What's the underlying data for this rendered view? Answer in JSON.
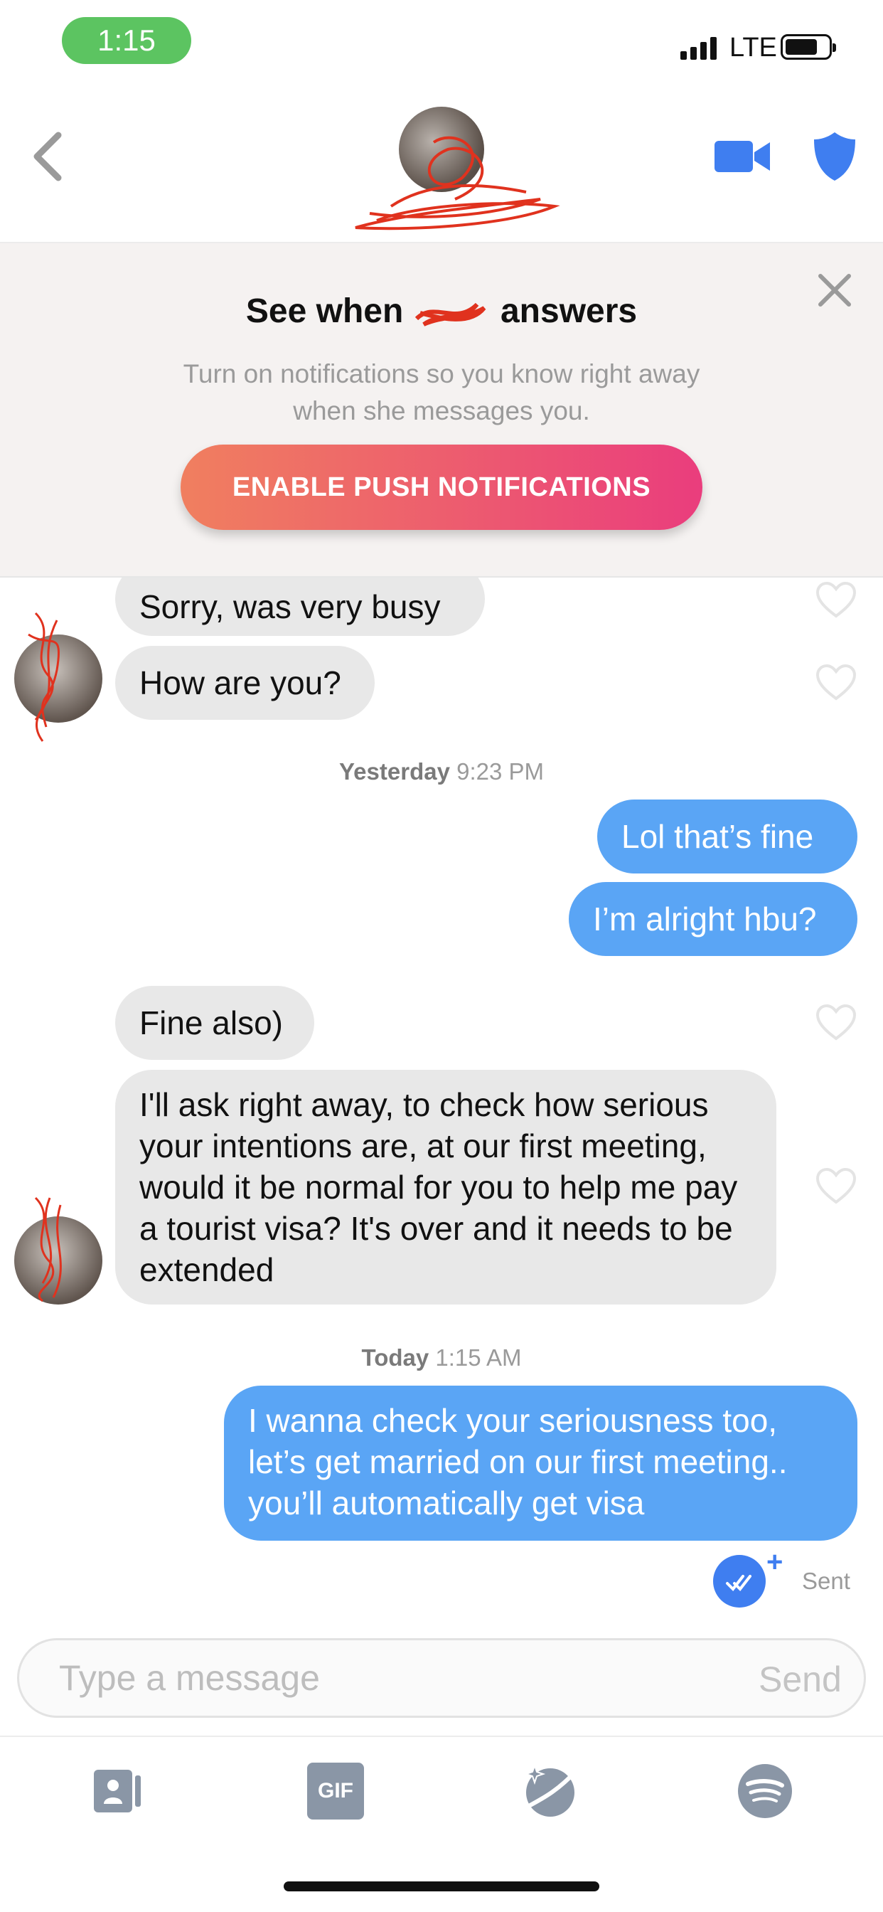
{
  "status_bar": {
    "time": "1:15",
    "network": "LTE"
  },
  "header": {
    "back_icon": "chevron-left-icon",
    "video_icon": "video-camera-icon",
    "safety_icon": "shield-icon",
    "accent_color": "#3f7ef0"
  },
  "banner": {
    "title_before": "See when",
    "title_after": "answers",
    "description": "Turn on notifications so you know right away when she messages you.",
    "button_label": "ENABLE PUSH NOTIFICATIONS",
    "close_icon": "close-icon",
    "gradient": [
      "#f07f5f",
      "#ea3d7d"
    ]
  },
  "messages": [
    {
      "direction": "in",
      "text": "Sorry, was very busy"
    },
    {
      "direction": "in",
      "text": "How are you?"
    },
    {
      "direction": "out",
      "text": "Lol that’s fine"
    },
    {
      "direction": "out",
      "text": "I’m alright hbu?"
    },
    {
      "direction": "in",
      "text": "Fine also)"
    },
    {
      "direction": "in",
      "text": "I'll ask right away, to check how serious your intentions are, at our first meeting, would it be normal for you to help me pay a tourist visa? It's over and it needs to be extended"
    },
    {
      "direction": "out",
      "text": "I wanna check your seriousness too, let’s get married on our first meeting.. you’ll automatically get visa"
    }
  ],
  "timestamps": [
    {
      "day": "Yesterday",
      "time": "9:23 PM"
    },
    {
      "day": "Today",
      "time": "1:15 AM"
    }
  ],
  "delivery": {
    "status": "Sent",
    "plus": "+"
  },
  "composer": {
    "placeholder": "Type a message",
    "send_label": "Send"
  },
  "toolbar": {
    "items": [
      {
        "icon": "contact-card-icon"
      },
      {
        "icon": "gif-icon",
        "label": "GIF"
      },
      {
        "icon": "sparkle-planet-icon"
      },
      {
        "icon": "spotify-icon"
      }
    ]
  },
  "colors": {
    "incoming_bubble": "#e8e8e8",
    "outgoing_bubble": "#5aa5f5",
    "online_pill": "#5cc461"
  }
}
